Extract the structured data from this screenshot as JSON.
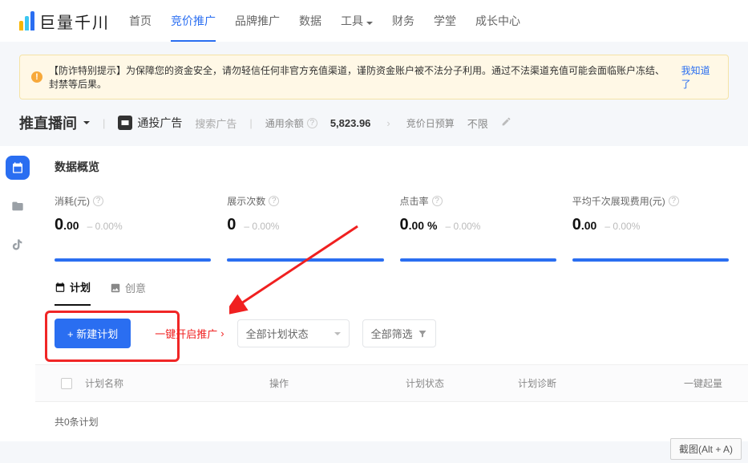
{
  "brand": "巨量千川",
  "nav": {
    "items": [
      "首页",
      "竞价推广",
      "品牌推广",
      "数据",
      "工具",
      "财务",
      "学堂",
      "成长中心"
    ],
    "active_index": 1,
    "with_caret": [
      4
    ]
  },
  "warning": {
    "text": "【防诈特别提示】为保障您的资金安全，请勿轻信任何非官方充值渠道，谨防资金账户被不法分子利用。通过不法渠道充值可能会面临账户冻结、封禁等后果。",
    "link_text": "我知道了"
  },
  "sub": {
    "room_title": "推直播间",
    "ad_type": "通投广告",
    "search_placeholder": "搜索广告",
    "balance_label": "通用余额",
    "balance_value": "5,823.96",
    "budget_label": "竞价日预算",
    "budget_value": "不限"
  },
  "overview_title": "数据概览",
  "stats": [
    {
      "label": "消耗(元)",
      "value": "0",
      "decimal": ".00",
      "delta": "0.00%"
    },
    {
      "label": "展示次数",
      "value": "0",
      "decimal": "",
      "delta": "0.00%"
    },
    {
      "label": "点击率",
      "value": "0",
      "decimal": ".00 %",
      "delta": "0.00%"
    },
    {
      "label": "平均千次展现费用(元)",
      "value": "0",
      "decimal": ".00",
      "delta": "0.00%"
    }
  ],
  "subtabs": {
    "plan": "计划",
    "creative": "创意",
    "active": "plan"
  },
  "actions": {
    "new_plan": "新建计划",
    "onekey": "一键开启推广",
    "status_select": "全部计划状态",
    "filter": "全部筛选"
  },
  "table": {
    "headers": {
      "name": "计划名称",
      "op": "操作",
      "status": "计划状态",
      "diag": "计划诊断",
      "start": "一键起量"
    },
    "summary": "共0条计划"
  },
  "screenshot_tip": "截图(Alt + A)"
}
